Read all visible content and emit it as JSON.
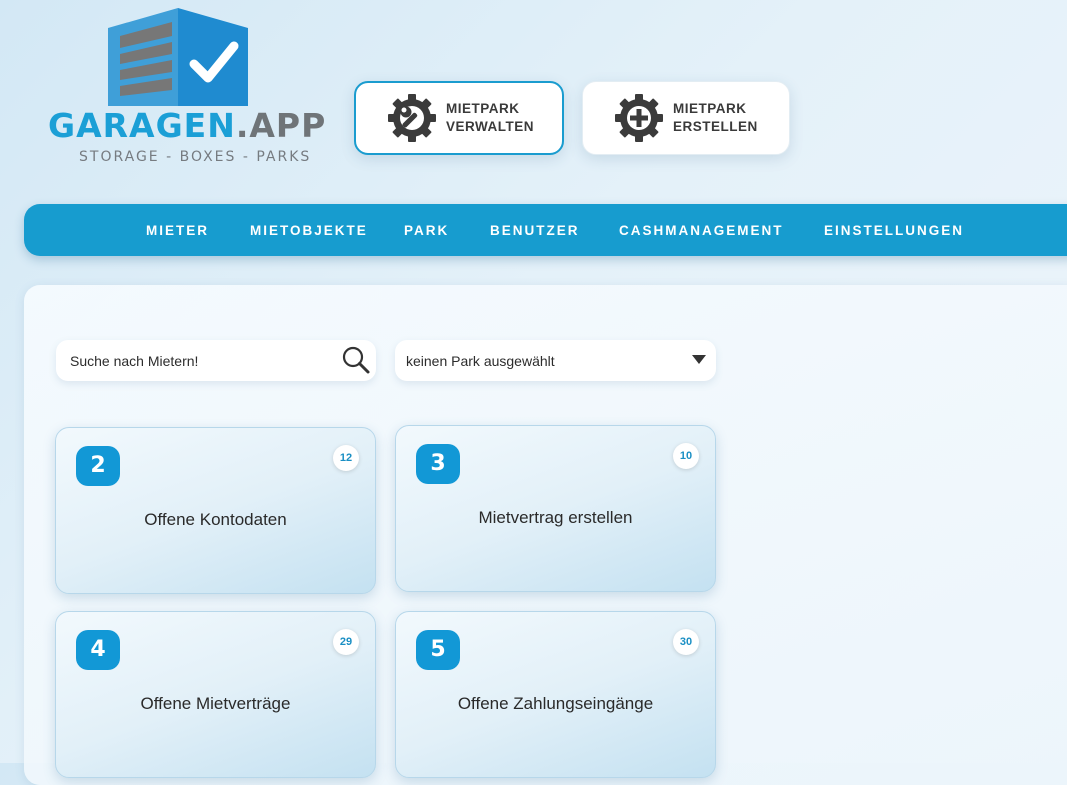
{
  "logo": {
    "name_main": "GARAGEN",
    "name_suffix": ".APP",
    "tagline": "STORAGE - BOXES - PARKS",
    "colors": {
      "blue": "#1b9fd6",
      "grey": "#6f7478"
    }
  },
  "actions": [
    {
      "label_line1": "MIETPARK",
      "label_line2": "VERWALTEN",
      "icon": "gear-wrench-icon"
    },
    {
      "label_line1": "MIETPARK",
      "label_line2": "ERSTELLEN",
      "icon": "gear-plus-icon"
    }
  ],
  "nav": {
    "items": [
      "MIETER",
      "MIETOBJEKTE",
      "PARK",
      "BENUTZER",
      "CASHMANAGEMENT",
      "EINSTELLUNGEN"
    ],
    "color": "#179ccf"
  },
  "search": {
    "value": "Suche nach Mietern!",
    "icon": "search-icon"
  },
  "park_select": {
    "value": "keinen Park ausgewählt",
    "icon": "chevron-down-icon"
  },
  "cards": [
    {
      "number": "2",
      "badge": "12",
      "title": "Offene Kontodaten"
    },
    {
      "number": "3",
      "badge": "10",
      "title": "Mietvertrag erstellen"
    },
    {
      "number": "4",
      "badge": "29",
      "title": "Offene Mietverträge"
    },
    {
      "number": "5",
      "badge": "30",
      "title": "Offene Zahlungseingänge"
    }
  ]
}
